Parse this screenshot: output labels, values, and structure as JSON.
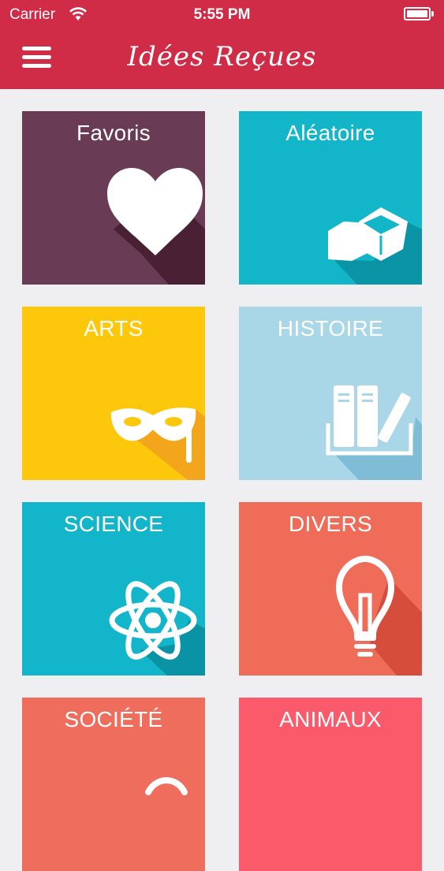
{
  "status_bar": {
    "carrier": "Carrier",
    "time": "5:55 PM"
  },
  "header": {
    "title": "Idées Reçues",
    "menu_icon": "hamburger-menu-icon",
    "color": "#d02c47"
  },
  "tiles": [
    {
      "label": "Favoris",
      "icon": "heart-icon",
      "color": "#6a3b54",
      "shadow": "#4a2035"
    },
    {
      "label": "Aléatoire",
      "icon": "dice-cubes-icon",
      "color": "#13b5c9",
      "shadow": "#0a94a6"
    },
    {
      "label": "ARTS",
      "icon": "theater-mask-icon",
      "color": "#fdc80c",
      "shadow": "#f3a51c"
    },
    {
      "label": "HISTOIRE",
      "icon": "books-icon",
      "color": "#a9d7e8",
      "shadow": "#7fbcd6"
    },
    {
      "label": "SCIENCE",
      "icon": "atom-icon",
      "color": "#12b5c9",
      "shadow": "#0a93a5"
    },
    {
      "label": "DIVERS",
      "icon": "lightbulb-icon",
      "color": "#ef6c58",
      "shadow": "#d64d3b"
    },
    {
      "label": "SOCIÉTÉ",
      "icon": "society-icon",
      "color": "#ef6d5c",
      "shadow": "#d8503f"
    },
    {
      "label": "ANIMAUX",
      "icon": "animal-icon",
      "color": "#fb5a6a",
      "shadow": "#df3d4e"
    }
  ]
}
